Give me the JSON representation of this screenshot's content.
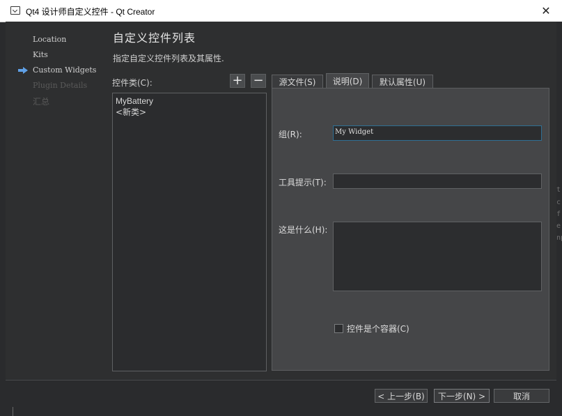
{
  "window": {
    "title": "Qt4 设计师自定义控件 - Qt Creator",
    "close_glyph": "✕"
  },
  "steps": [
    {
      "label": "Location",
      "state": "done"
    },
    {
      "label": "Kits",
      "state": "done"
    },
    {
      "label": "Custom Widgets",
      "state": "current"
    },
    {
      "label": "Plugin Details",
      "state": "pending"
    },
    {
      "label": "汇总",
      "state": "pending"
    }
  ],
  "page": {
    "title": "自定义控件列表",
    "subtitle": "指定自定义控件列表及其属性."
  },
  "class_list": {
    "label": "控件类(C):",
    "add_glyph": "+",
    "remove_glyph": "−",
    "items": [
      "MyBattery",
      "<新类>"
    ]
  },
  "tabs": [
    {
      "label": "源文件(S)",
      "active": false
    },
    {
      "label": "说明(D)",
      "active": true
    },
    {
      "label": "默认属性(U)",
      "active": false
    }
  ],
  "form": {
    "group_label": "组(R):",
    "group_value": "My Widget",
    "tooltip_label": "工具提示(T):",
    "tooltip_value": "",
    "whatsthis_label": "这是什么(H):",
    "container_label": "控件是个容器(C)",
    "container_checked": false
  },
  "footer": {
    "back_label": "< 上一步(B)",
    "next_label": "下一步(N) >",
    "cancel_label": "取消"
  },
  "edge_text": [
    "t",
    "c",
    "f",
    "e",
    "np"
  ],
  "colors": {
    "accent": "#2f6f94",
    "arrow": "#5fa0e6",
    "background": "#2e2f30"
  }
}
